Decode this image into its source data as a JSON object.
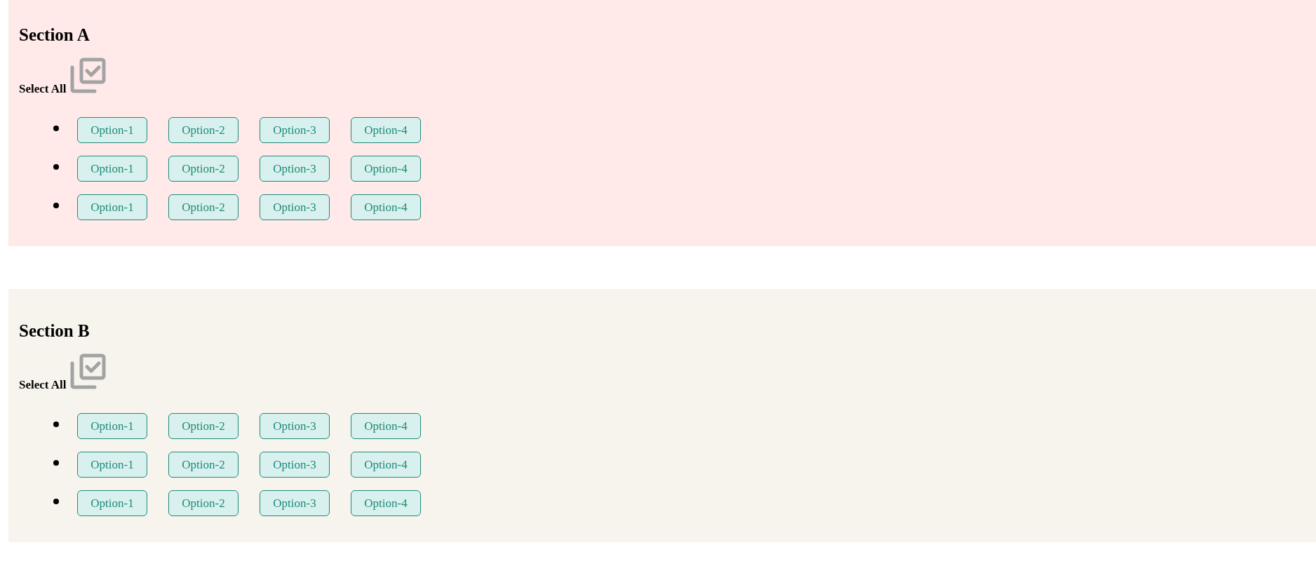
{
  "sections": [
    {
      "title": "Section A",
      "color": "#ffe9e9",
      "select_all": "Select All",
      "rows": [
        [
          "Option-1",
          "Option-2",
          "Option-3",
          "Option-4"
        ],
        [
          "Option-1",
          "Option-2",
          "Option-3",
          "Option-4"
        ],
        [
          "Option-1",
          "Option-2",
          "Option-3",
          "Option-4"
        ]
      ]
    },
    {
      "title": "Section B",
      "color": "#f7f4ee",
      "select_all": "Select All",
      "rows": [
        [
          "Option-1",
          "Option-2",
          "Option-3",
          "Option-4"
        ],
        [
          "Option-1",
          "Option-2",
          "Option-3",
          "Option-4"
        ],
        [
          "Option-1",
          "Option-2",
          "Option-3",
          "Option-4"
        ]
      ]
    }
  ]
}
